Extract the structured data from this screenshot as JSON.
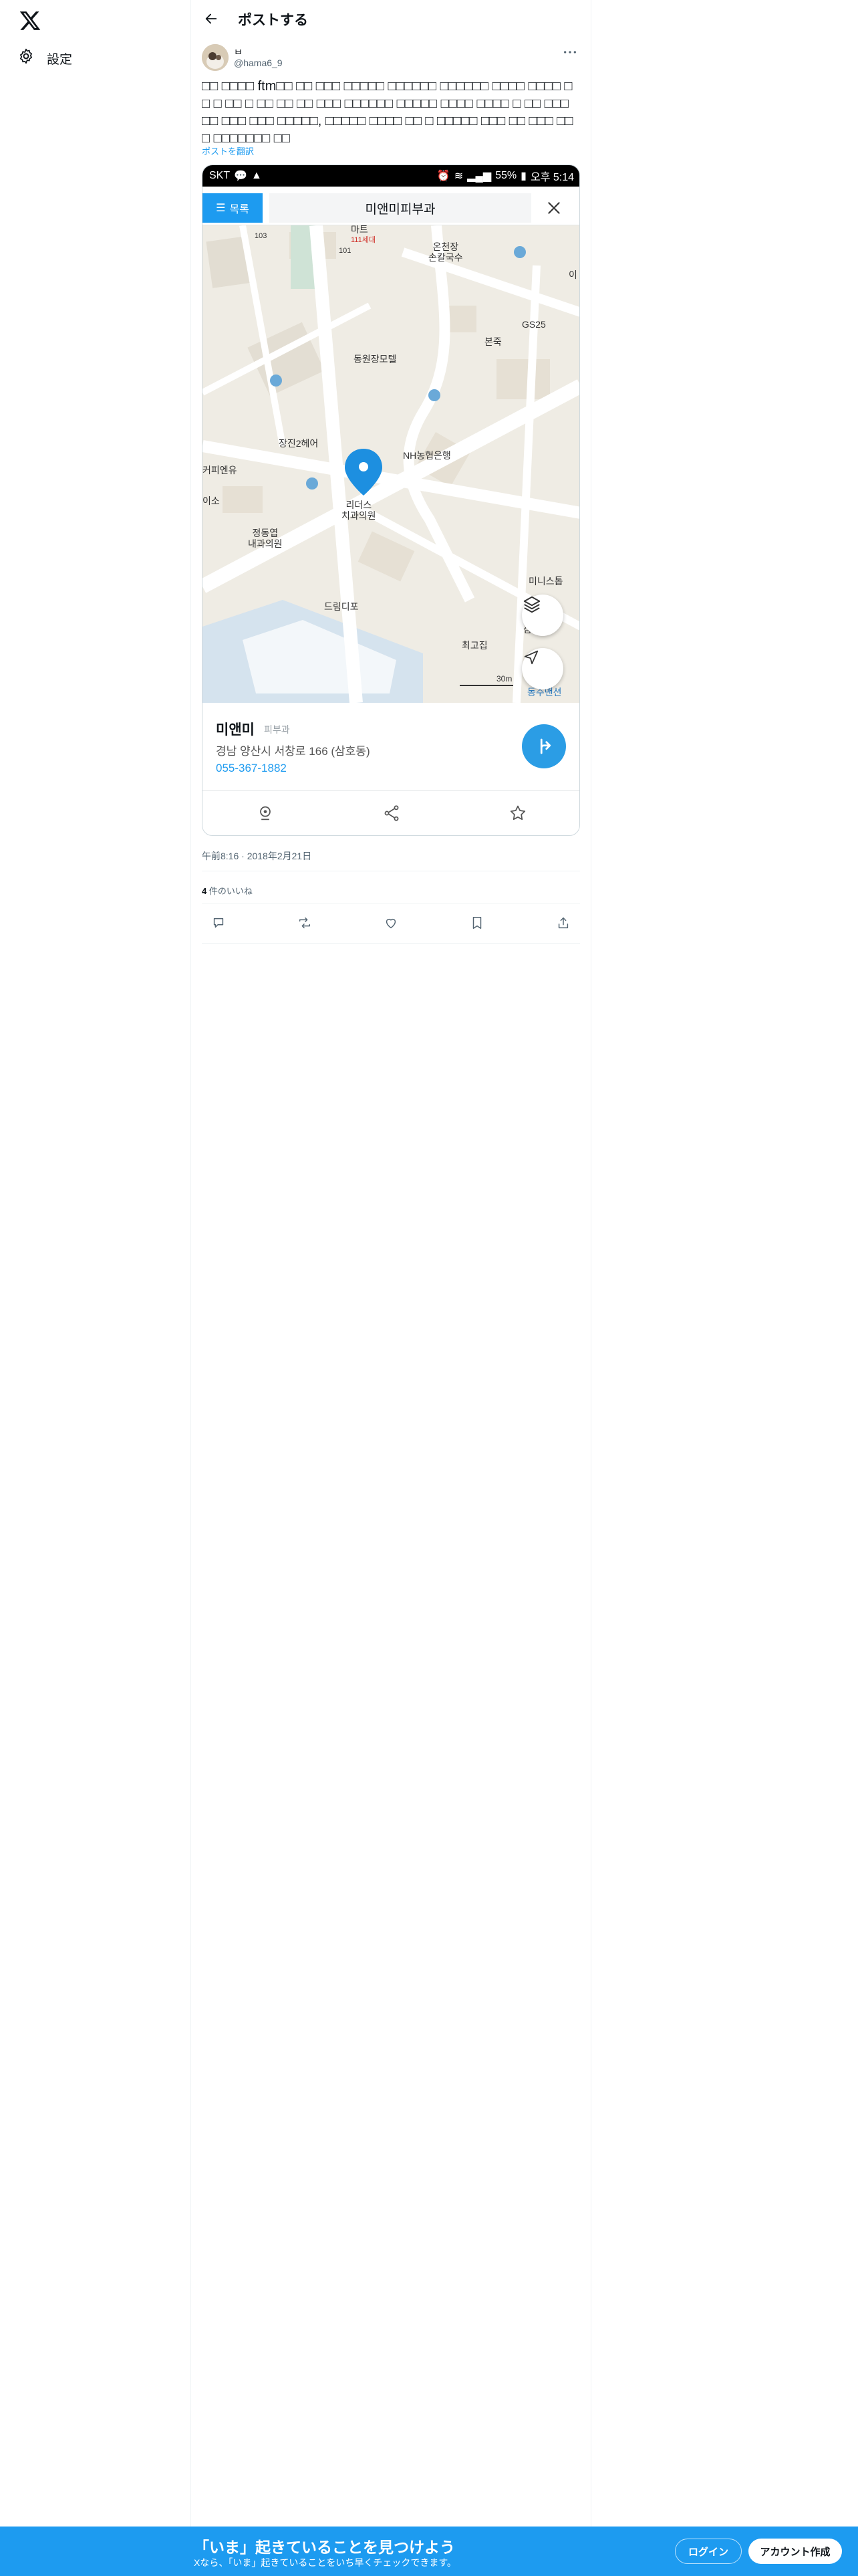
{
  "nav": {
    "logo": "x-logo",
    "settings_label": "設定"
  },
  "header": {
    "title": "ポストする"
  },
  "post": {
    "author_name": "ㅂ",
    "author_handle": "@hama6_9",
    "text": "□□ □□□□ ftm□□ □□ □□□ □□□□□ □□□□□□ □□□□□□ □□□□ □□□□ □ □ □ □□ □ □□ □□ □□ □□□ □□□□□□ □□□□□ □□□□ □□□□ □ □□ □□□ □□ □□□ □□□ □□□□□, □□□□□ □□□□ □□ □ □□□□□ □□□ □□ □□□ □□ □ □□□□□□□ □□",
    "translate_label": "ポストを翻訳",
    "timestamp": "午前8:16 · 2018年2月21日",
    "likes_count": "4",
    "likes_label": "件のいいね"
  },
  "screenshot": {
    "status_left": "SKT",
    "status_battery": "55%",
    "status_time": "오후 5:14",
    "list_button": "목록",
    "search_title": "미앤미피부과",
    "map_labels": {
      "mart": "마트",
      "building": "111세대",
      "n101": "101",
      "n103": "103",
      "noodle": "온천장\n손칼국수",
      "gs25": "GS25",
      "bonjuk": "본죽",
      "motel": "동원장모텔",
      "hair": "장진2헤어",
      "coffee": "커피엔유",
      "nh": "NH농협은행",
      "dental": "리더스\n치과의원",
      "clinic": "정동엽\n내과의원",
      "iso": "이소",
      "dreamdepot": "드림디포",
      "ministop": "미니스톱",
      "choigojip": "최고집",
      "samsung": "삼성",
      "mansion": "동주맨션",
      "scale": "30m",
      "i": "이"
    },
    "place_name": "미앤미",
    "place_category": "피부과",
    "place_address": "경남 양산시 서창로 166 (삼호동)",
    "place_phone": "055-367-1882"
  },
  "banner": {
    "title": "「いま」起きていることを見つけよう",
    "subtitle": "Xなら、「いま」起きていることをいち早くチェックできます。",
    "login": "ログイン",
    "signup": "アカウント作成"
  },
  "colors": {
    "accent": "#1d9bf0",
    "map_background": "#efece4",
    "pin": "#1d8fe0"
  }
}
